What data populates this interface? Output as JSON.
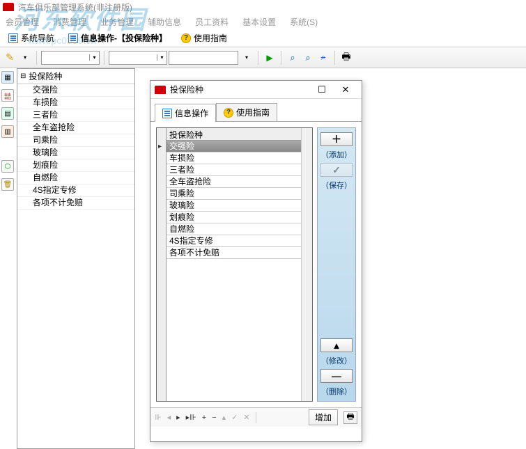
{
  "watermark": {
    "main": "河东软件园",
    "sub": "www.pc0359.cn"
  },
  "app": {
    "title": "汽车俱乐部管理系统(非注册版)"
  },
  "menu": {
    "items": [
      "会员管理",
      "消费管理",
      "业务管理",
      "辅助信息",
      "员工资料",
      "基本设置",
      "系统(S)"
    ]
  },
  "main_tabs": {
    "nav_label": "系统导航",
    "active_label": "信息操作-【投保险种】",
    "guide_label": "使用指南"
  },
  "tree": {
    "header": "投保险种",
    "items": [
      "交强险",
      "车损险",
      "三者险",
      "全车盗抢险",
      "司乘险",
      "玻璃险",
      "划痕险",
      "自燃险",
      "4S指定专修",
      "各项不计免赔"
    ]
  },
  "dialog": {
    "title": "投保险种",
    "tabs": {
      "info": "信息操作",
      "guide": "使用指南"
    },
    "grid": {
      "header": "投保险种",
      "selected_index": 0,
      "rows": [
        "交强险",
        "车损险",
        "三者险",
        "全车盗抢险",
        "司乘险",
        "玻璃险",
        "划痕险",
        "自燃险",
        "4S指定专修",
        "各项不计免赔"
      ]
    },
    "actions": {
      "add": "（添加）",
      "save": "（保存）",
      "modify": "（修改）",
      "delete": "（删除）"
    },
    "footer": {
      "add_button": "增加"
    }
  }
}
